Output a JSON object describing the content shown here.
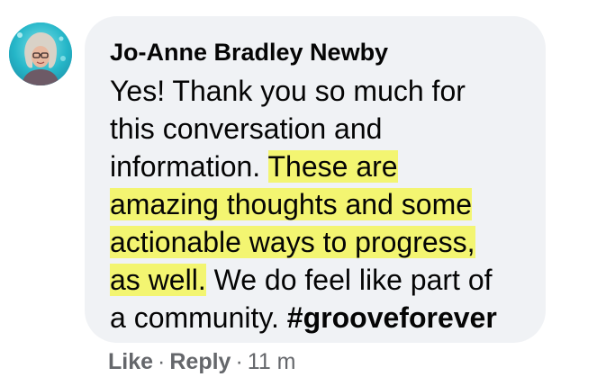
{
  "comment": {
    "author": "Jo-Anne Bradley Newby",
    "lines": {
      "l1": "Yes! Thank you so much for",
      "l2": "this conversation and",
      "l3_plain": "information. ",
      "l3_highlight": "These are",
      "l4_highlight": "amazing thoughts and some",
      "l5_highlight": "actionable ways to progress,",
      "l6_highlight": "as well.",
      "l6_plain": " We do feel like part of",
      "l7_plain": "a community. ",
      "l7_hashtag": "#grooveforever"
    },
    "highlight_color": "#f3f571",
    "bubble_color": "#f0f2f5"
  },
  "actions": {
    "like": "Like",
    "separator": "·",
    "reply": "Reply",
    "timestamp": "11 m"
  },
  "colors": {
    "text": "#050505",
    "meta": "#65676b",
    "avatar_bg": "#33bfd0"
  }
}
